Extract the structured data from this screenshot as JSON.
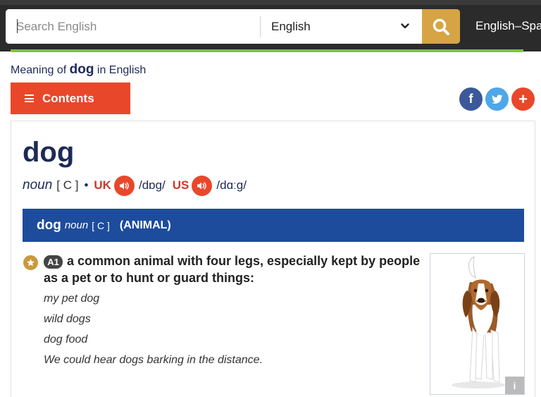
{
  "search": {
    "placeholder": "Search English"
  },
  "language_select": {
    "value": "English"
  },
  "dictionary_label": "English–Spanish",
  "breadcrumb": {
    "prefix": "Meaning of",
    "word": "dog",
    "suffix": "in English"
  },
  "contents_button": "Contents",
  "social": {
    "facebook": "f",
    "plus": "+"
  },
  "entry": {
    "headword": "dog",
    "pos": "noun",
    "grammar": "[ C ]",
    "separator": "•",
    "uk_label": "UK",
    "uk_ipa": "/dɒɡ/",
    "us_label": "US",
    "us_ipa": "/dɑːɡ/"
  },
  "sense": {
    "headword": "dog",
    "pos": "noun",
    "grammar": "[ C ]",
    "guideword": "(ANIMAL)",
    "level": "A1",
    "definition": "a common animal with four legs, especially kept by people as a pet or to hunt or guard things:",
    "examples": [
      "my pet dog",
      "wild dogs",
      "dog food",
      "We could hear dogs barking in the distance."
    ],
    "image_info": "i"
  },
  "colors": {
    "topbar": "#2b2b2b",
    "search_button": "#d6a444",
    "accent_green": "#7cc242",
    "contents_red": "#e9472a",
    "sense_blue": "#1e4c9c"
  }
}
